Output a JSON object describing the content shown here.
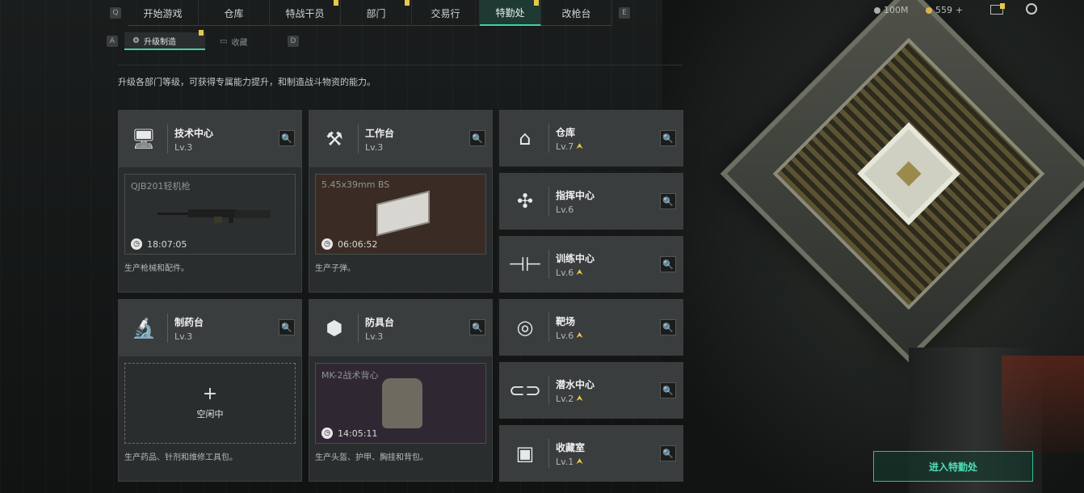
{
  "top_nav": {
    "key_left": "Q",
    "key_right": "E",
    "tabs": [
      {
        "label": "开始游戏",
        "flag": false,
        "active": false
      },
      {
        "label": "仓库",
        "flag": false,
        "active": false
      },
      {
        "label": "特战干员",
        "flag": true,
        "active": false
      },
      {
        "label": "部门",
        "flag": true,
        "active": false
      },
      {
        "label": "交易行",
        "flag": false,
        "active": false
      },
      {
        "label": "特勤处",
        "flag": true,
        "active": true
      },
      {
        "label": "改枪台",
        "flag": false,
        "active": false
      }
    ],
    "resources": {
      "silver": "100M",
      "coin": "559"
    }
  },
  "sub_nav": {
    "key_left": "A",
    "key_right": "D",
    "tabs": [
      {
        "label": "升级制造",
        "active": true
      },
      {
        "label": "收藏",
        "active": false
      }
    ]
  },
  "description": "升级各部门等级，可获得专属能力提升，和制造战斗物资的能力。",
  "stations": {
    "tech": {
      "name": "技术中心",
      "level": "Lv.3",
      "product": "QJB201轻机枪",
      "time": "18:07:05",
      "desc": "生产枪械和配件。"
    },
    "workbench": {
      "name": "工作台",
      "level": "Lv.3",
      "product": "5.45x39mm BS",
      "time": "06:06:52",
      "desc": "生产子弹。"
    },
    "pharmacy": {
      "name": "制药台",
      "level": "Lv.3",
      "idle_label": "空闲中",
      "desc": "生产药品、针剂和维修工具包。"
    },
    "armor": {
      "name": "防具台",
      "level": "Lv.3",
      "product": "MK-2战术背心",
      "time": "14:05:11",
      "desc": "生产头盔、护甲、胸挂和背包。"
    }
  },
  "side_rooms": [
    {
      "name": "仓库",
      "level": "Lv.7",
      "upgradable": true,
      "icon": "warehouse-icon"
    },
    {
      "name": "指挥中心",
      "level": "Lv.6",
      "upgradable": false,
      "icon": "command-icon"
    },
    {
      "name": "训练中心",
      "level": "Lv.6",
      "upgradable": true,
      "icon": "dumbbell-icon"
    },
    {
      "name": "靶场",
      "level": "Lv.6",
      "upgradable": true,
      "icon": "target-icon"
    },
    {
      "name": "潜水中心",
      "level": "Lv.2",
      "upgradable": true,
      "icon": "goggles-icon"
    },
    {
      "name": "收藏室",
      "level": "Lv.1",
      "upgradable": true,
      "icon": "collection-icon"
    }
  ],
  "enter_button": "进入特勤处",
  "colors": {
    "accent": "#3fd0a5",
    "flag": "#e8c84a"
  }
}
